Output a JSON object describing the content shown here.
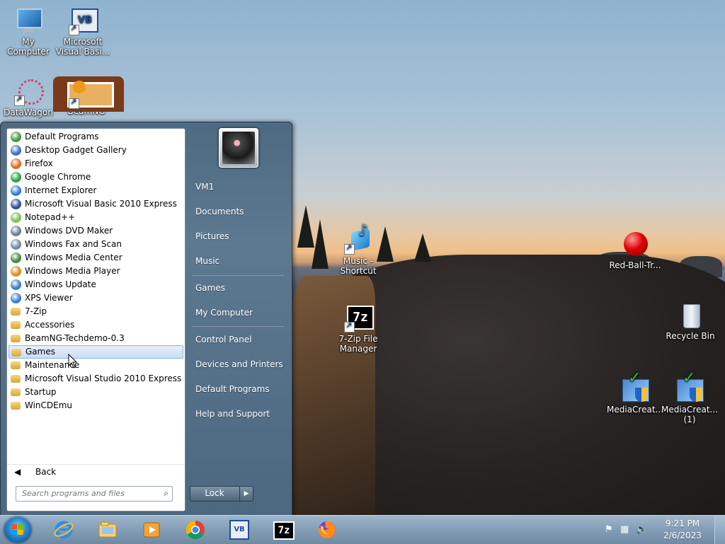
{
  "desktop": {
    "icons": [
      {
        "name": "my-computer",
        "label": "My Computer"
      },
      {
        "name": "ms-visual-basic",
        "label": "Microsoft Visual Basi..."
      },
      {
        "name": "datawagon",
        "label": "DataWagon"
      },
      {
        "name": "beamng",
        "label": "BeamNG"
      },
      {
        "name": "music-shortcut",
        "label": "Music - Shortcut"
      },
      {
        "name": "7zip-file-manager",
        "label": "7-Zip File Manager"
      },
      {
        "name": "red-ball",
        "label": "Red-Ball-Tr..."
      },
      {
        "name": "recycle-bin",
        "label": "Recycle Bin"
      },
      {
        "name": "mediacreat-1",
        "label": "MediaCreat..."
      },
      {
        "name": "mediacreat-2",
        "label": "MediaCreat... (1)"
      }
    ]
  },
  "start_menu": {
    "programs": [
      {
        "label": "Default Programs",
        "icon": "default-programs-icon",
        "color": "#3c9a3c"
      },
      {
        "label": "Desktop Gadget Gallery",
        "icon": "gadget-gallery-icon",
        "color": "#3b6fb6"
      },
      {
        "label": "Firefox",
        "icon": "firefox-icon",
        "color": "#e8671c"
      },
      {
        "label": "Google Chrome",
        "icon": "chrome-icon",
        "color": "#2f9e44"
      },
      {
        "label": "Internet Explorer",
        "icon": "internet-explorer-icon",
        "color": "#2f7fd1"
      },
      {
        "label": "Microsoft Visual Basic 2010 Express",
        "icon": "visual-basic-icon",
        "color": "#2b4f9a"
      },
      {
        "label": "Notepad++",
        "icon": "notepad-plus-plus-icon",
        "color": "#7fbf4f"
      },
      {
        "label": "Windows DVD Maker",
        "icon": "dvd-maker-icon",
        "color": "#6a7f95"
      },
      {
        "label": "Windows Fax and Scan",
        "icon": "fax-scan-icon",
        "color": "#6a8aa8"
      },
      {
        "label": "Windows Media Center",
        "icon": "media-center-icon",
        "color": "#3d8a3d"
      },
      {
        "label": "Windows Media Player",
        "icon": "media-player-icon",
        "color": "#e08a1f"
      },
      {
        "label": "Windows Update",
        "icon": "windows-update-icon",
        "color": "#3a7fc4"
      },
      {
        "label": "XPS Viewer",
        "icon": "xps-viewer-icon",
        "color": "#3a7fd1"
      },
      {
        "label": "7-Zip",
        "icon": "folder-icon",
        "color": "#d7a63a"
      },
      {
        "label": "Accessories",
        "icon": "folder-icon",
        "color": "#d7a63a"
      },
      {
        "label": "BeamNG-Techdemo-0.3",
        "icon": "folder-icon",
        "color": "#d7a63a"
      },
      {
        "label": "Games",
        "icon": "folder-icon",
        "color": "#d7a63a",
        "selected": true
      },
      {
        "label": "Maintenance",
        "icon": "folder-icon",
        "color": "#d7a63a"
      },
      {
        "label": "Microsoft Visual Studio 2010 Express",
        "icon": "folder-icon",
        "color": "#d7a63a"
      },
      {
        "label": "Startup",
        "icon": "folder-icon",
        "color": "#d7a63a"
      },
      {
        "label": "WinCDEmu",
        "icon": "folder-icon",
        "color": "#d7a63a"
      }
    ],
    "back_label": "Back",
    "search_placeholder": "Search programs and files",
    "right_items": [
      {
        "name": "vm1",
        "label": "VM1"
      },
      {
        "name": "documents",
        "label": "Documents"
      },
      {
        "name": "pictures",
        "label": "Pictures"
      },
      {
        "name": "music",
        "label": "Music"
      },
      {
        "name": "games",
        "label": "Games"
      },
      {
        "name": "my-computer",
        "label": "My Computer"
      },
      {
        "name": "control-panel",
        "label": "Control Panel"
      },
      {
        "name": "devices-and-printers",
        "label": "Devices and Printers"
      },
      {
        "name": "default-programs",
        "label": "Default Programs"
      },
      {
        "name": "help-and-support",
        "label": "Help and Support"
      }
    ],
    "lock_label": "Lock"
  },
  "taskbar": {
    "pinned": [
      "internet-explorer-icon",
      "file-explorer-icon",
      "media-player-icon",
      "chrome-icon",
      "visual-basic-icon",
      "7zip-icon",
      "firefox-icon"
    ],
    "seven_zip_text": "7z",
    "vb_text": "VB",
    "time": "9:21 PM",
    "date": "2/6/2023"
  }
}
